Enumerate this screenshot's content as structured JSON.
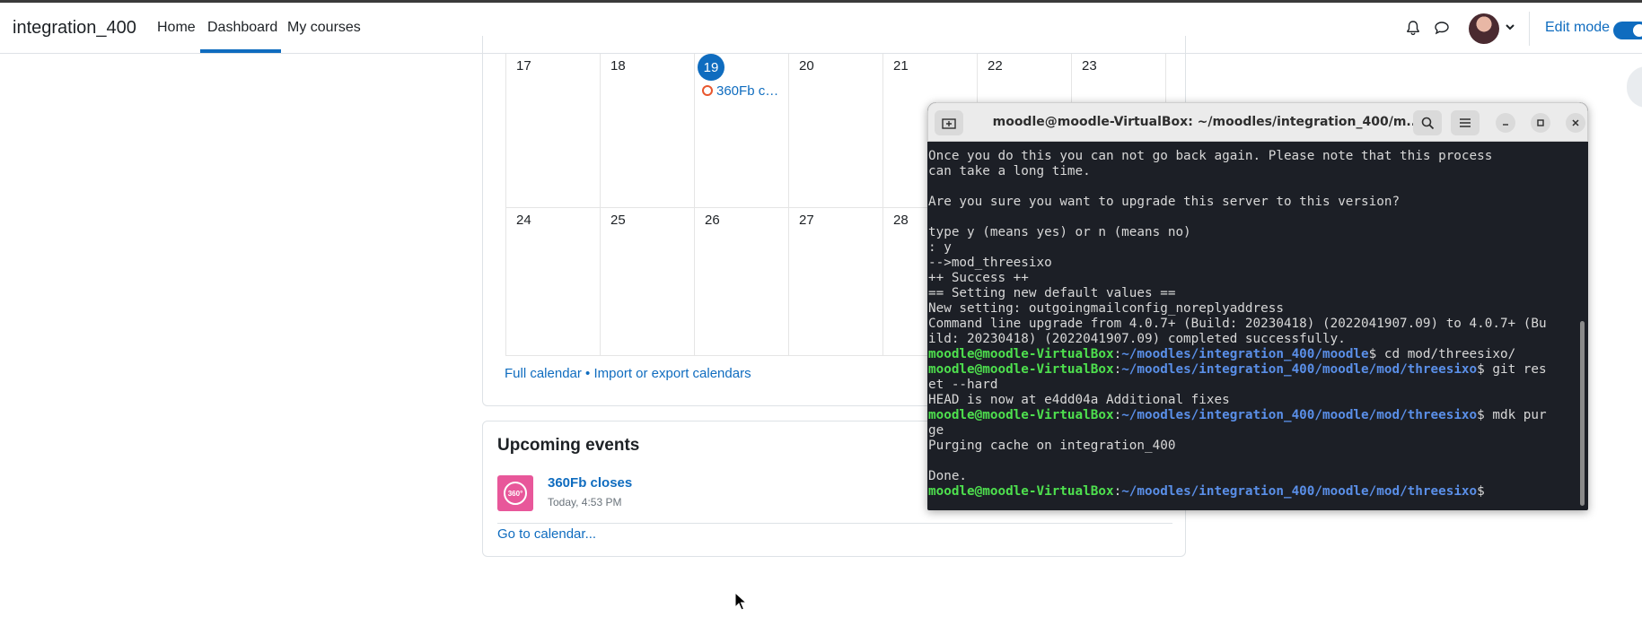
{
  "navbar": {
    "site_name": "integration_400",
    "links": [
      "Home",
      "Dashboard",
      "My courses"
    ],
    "edit_mode_label": "Edit mode"
  },
  "calendar": {
    "week1": [
      "17",
      "18",
      "19",
      "20",
      "21",
      "22",
      "23"
    ],
    "week2": [
      "24",
      "25",
      "26",
      "27",
      "28"
    ],
    "today": "19",
    "event_label": "360Fb c…",
    "footer_full": "Full calendar",
    "footer_sep": " • ",
    "footer_import": "Import or export calendars"
  },
  "upcoming": {
    "title": "Upcoming events",
    "event_icon_text": "360°",
    "event_name": "360Fb closes",
    "event_time": "Today, 4:53 PM",
    "go_to_calendar": "Go to calendar..."
  },
  "terminal": {
    "title": "moodle@moodle-VirtualBox: ~/moodles/integration_400/m...",
    "lines": [
      {
        "text": "Once you do this you can not go back again. Please note that this process"
      },
      {
        "text": "can take a long time."
      },
      {
        "text": ""
      },
      {
        "text": "Are you sure you want to upgrade this server to this version?"
      },
      {
        "text": ""
      },
      {
        "text": "type y (means yes) or n (means no)"
      },
      {
        "text": ": y"
      },
      {
        "text": "-->mod_threesixo"
      },
      {
        "text": "++ Success ++"
      },
      {
        "text": "== Setting new default values =="
      },
      {
        "text": "New setting: outgoingmailconfig_noreplyaddress"
      },
      {
        "text": "Command line upgrade from 4.0.7+ (Build: 20230418) (2022041907.09) to 4.0.7+ (Bu"
      },
      {
        "text": "ild: 20230418) (2022041907.09) completed successfully."
      },
      {
        "user": "moodle@moodle-VirtualBox",
        "path": "~/moodles/integration_400/moodle",
        "cmd": "$ cd mod/threesixo/"
      },
      {
        "user": "moodle@moodle-VirtualBox",
        "path": "~/moodles/integration_400/moodle/mod/threesixo",
        "cmd": "$ git res"
      },
      {
        "text": "et --hard"
      },
      {
        "text": "HEAD is now at e4dd04a Additional fixes"
      },
      {
        "user": "moodle@moodle-VirtualBox",
        "path": "~/moodles/integration_400/moodle/mod/threesixo",
        "cmd": "$ mdk pur"
      },
      {
        "text": "ge"
      },
      {
        "text": "Purging cache on integration_400"
      },
      {
        "text": ""
      },
      {
        "text": "Done."
      },
      {
        "user": "moodle@moodle-VirtualBox",
        "path": "~/moodles/integration_400/moodle/mod/threesixo",
        "cmd": "$ "
      }
    ]
  },
  "colors": {
    "brand_blue": "#0f6cbf",
    "event_pink": "#e8579a",
    "terminal_bg": "#1c1f26",
    "prompt_user": "#4ee04e",
    "prompt_path": "#5a8fe8"
  }
}
